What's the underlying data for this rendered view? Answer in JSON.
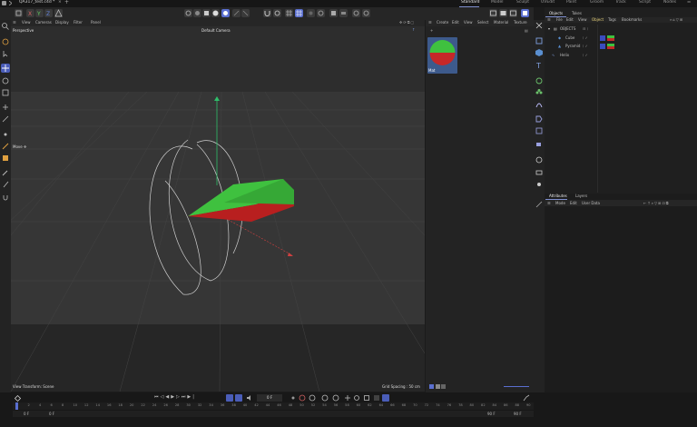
{
  "app": {
    "file_tab": "QA317_test.c4d *",
    "layout_tabs": [
      "Standard",
      "Model",
      "Sculpt",
      "UVEdit",
      "Paint",
      "Groom",
      "Track",
      "Script",
      "Nodes"
    ],
    "active_layout": "Standard"
  },
  "viewport": {
    "menu": [
      "View",
      "Cameras",
      "Display",
      "Filter",
      "Panel"
    ],
    "view_name": "Perspective",
    "camera": "Default Camera ",
    "move_label": "Move",
    "view_transform": "View Transform: Scene",
    "grid_spacing": "Grid Spacing : 50 cm"
  },
  "material_manager": {
    "menu": [
      "Create",
      "Edit",
      "View",
      "Select",
      "Material",
      "Texture"
    ],
    "material_name": "Mat"
  },
  "objects_panel": {
    "tabs": [
      "Objects",
      "Takes"
    ],
    "menu": [
      "File",
      "Edit",
      "View",
      "Object",
      "Tags",
      "Bookmarks"
    ],
    "root": "OBJECTS",
    "items": [
      {
        "name": "Cube"
      },
      {
        "name": "Pyramid"
      },
      {
        "name": "Helix"
      }
    ]
  },
  "attributes_panel": {
    "tabs": [
      "Attributes",
      "Layers"
    ],
    "menu": [
      "Mode",
      "Edit",
      "User Data"
    ]
  },
  "timeline": {
    "current_frame": "0 F",
    "start_frame": "0 F",
    "start_frame_2": "0 F",
    "end_frame": "90 F",
    "end_frame_2": "90 F",
    "ticks": [
      "0",
      "2",
      "4",
      "6",
      "8",
      "10",
      "12",
      "14",
      "16",
      "18",
      "20",
      "22",
      "24",
      "26",
      "28",
      "30",
      "32",
      "34",
      "36",
      "38",
      "40",
      "42",
      "44",
      "46",
      "48",
      "50",
      "52",
      "54",
      "56",
      "58",
      "60",
      "62",
      "64",
      "66",
      "68",
      "70",
      "72",
      "74",
      "76",
      "78",
      "80",
      "82",
      "84",
      "86",
      "88",
      "90"
    ]
  },
  "colors": {
    "accent": "#5a6fd0",
    "green": "#3fc13f",
    "red": "#b81f1f",
    "axis_y": "#2fbf6a",
    "axis_x": "#d04040"
  }
}
